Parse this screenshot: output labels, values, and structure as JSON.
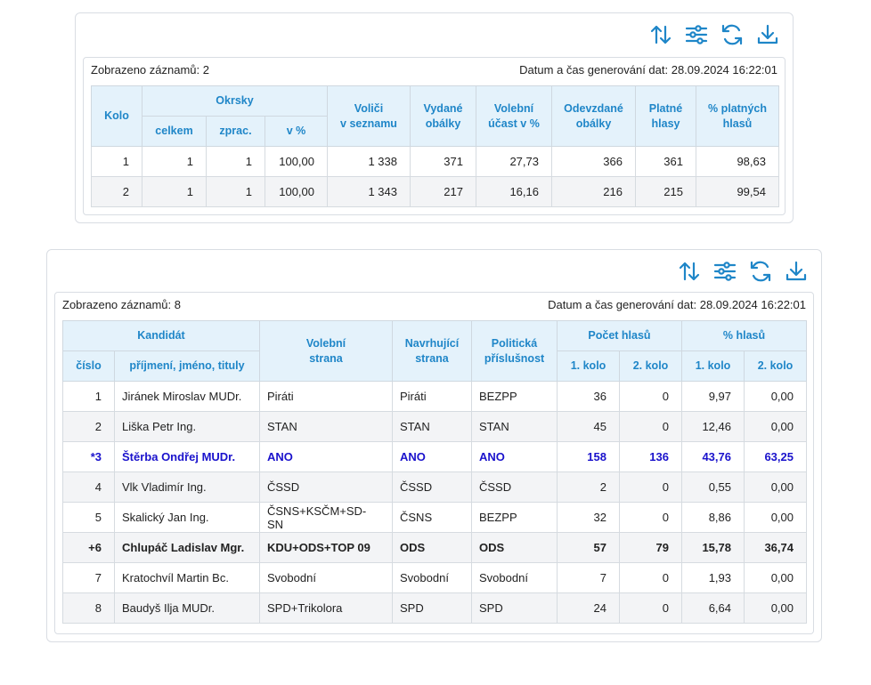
{
  "toolbar_icons": [
    "sort-icon",
    "filter-icon",
    "refresh-icon",
    "download-icon"
  ],
  "accent_color": "#1f86c8",
  "summary": {
    "records_label": "Zobrazeno záznamů: 2",
    "generated_label": "Datum a čas generování dat: 28.09.2024 16:22:01",
    "headers": {
      "kolo": "Kolo",
      "okrsky": "Okrsky",
      "celkem": "celkem",
      "zprac": "zprac.",
      "v_pct": "v %",
      "volici_line1": "Voliči",
      "volici_line2": "v seznamu",
      "vydane_line1": "Vydané",
      "vydane_line2": "obálky",
      "ucast_line1": "Volební",
      "ucast_line2": "účast v %",
      "odevzdane_line1": "Odevzdané",
      "odevzdane_line2": "obálky",
      "platne_line1": "Platné",
      "platne_line2": "hlasy",
      "pct_platnych_line1": "% platných",
      "pct_platnych_line2": "hlasů"
    },
    "rows": [
      [
        "1",
        "1",
        "1",
        "100,00",
        "1 338",
        "371",
        "27,73",
        "366",
        "361",
        "98,63"
      ],
      [
        "2",
        "1",
        "1",
        "100,00",
        "1 343",
        "217",
        "16,16",
        "216",
        "215",
        "99,54"
      ]
    ]
  },
  "candidates": {
    "records_label": "Zobrazeno záznamů: 8",
    "generated_label": "Datum a čas generování dat: 28.09.2024 16:22:01",
    "headers": {
      "kandidat": "Kandidát",
      "cislo": "číslo",
      "jmeno": "příjmení, jméno, tituly",
      "volebni_line1": "Volební",
      "volebni_line2": "strana",
      "navrhujici_line1": "Navrhující",
      "navrhujici_line2": "strana",
      "politicka_line1": "Politická",
      "politicka_line2": "příslušnost",
      "pocet": "Počet hlasů",
      "pct": "% hlasů",
      "kolo1": "1. kolo",
      "kolo2": "2. kolo",
      "pkolo1": "1. kolo",
      "pkolo2": "2. kolo"
    },
    "rows": [
      {
        "cislo": "1",
        "jmeno": "Jiránek Miroslav MUDr.",
        "volebni": "Piráti",
        "navrhujici": "Piráti",
        "prislusnost": "BEZPP",
        "k1": "36",
        "k2": "0",
        "p1": "9,97",
        "p2": "0,00",
        "style": "normal"
      },
      {
        "cislo": "2",
        "jmeno": "Liška Petr Ing.",
        "volebni": "STAN",
        "navrhujici": "STAN",
        "prislusnost": "STAN",
        "k1": "45",
        "k2": "0",
        "p1": "12,46",
        "p2": "0,00",
        "style": "normal"
      },
      {
        "cislo": "*3",
        "jmeno": "Štěrba Ondřej MUDr.",
        "volebni": "ANO",
        "navrhujici": "ANO",
        "prislusnost": "ANO",
        "k1": "158",
        "k2": "136",
        "p1": "43,76",
        "p2": "63,25",
        "style": "elected"
      },
      {
        "cislo": "4",
        "jmeno": "Vlk Vladimír Ing.",
        "volebni": "ČSSD",
        "navrhujici": "ČSSD",
        "prislusnost": "ČSSD",
        "k1": "2",
        "k2": "0",
        "p1": "0,55",
        "p2": "0,00",
        "style": "normal"
      },
      {
        "cislo": "5",
        "jmeno": "Skalický Jan Ing.",
        "volebni": "ČSNS+KSČM+SD-SN",
        "navrhujici": "ČSNS",
        "prislusnost": "BEZPP",
        "k1": "32",
        "k2": "0",
        "p1": "8,86",
        "p2": "0,00",
        "style": "normal"
      },
      {
        "cislo": "+6",
        "jmeno": "Chlupáč Ladislav Mgr.",
        "volebni": "KDU+ODS+TOP 09",
        "navrhujici": "ODS",
        "prislusnost": "ODS",
        "k1": "57",
        "k2": "79",
        "p1": "15,78",
        "p2": "36,74",
        "style": "bold"
      },
      {
        "cislo": "7",
        "jmeno": "Kratochvíl Martin Bc.",
        "volebni": "Svobodní",
        "navrhujici": "Svobodní",
        "prislusnost": "Svobodní",
        "k1": "7",
        "k2": "0",
        "p1": "1,93",
        "p2": "0,00",
        "style": "normal"
      },
      {
        "cislo": "8",
        "jmeno": "Baudyš Ilja MUDr.",
        "volebni": "SPD+Trikolora",
        "navrhujici": "SPD",
        "prislusnost": "SPD",
        "k1": "24",
        "k2": "0",
        "p1": "6,64",
        "p2": "0,00",
        "style": "normal"
      }
    ]
  }
}
